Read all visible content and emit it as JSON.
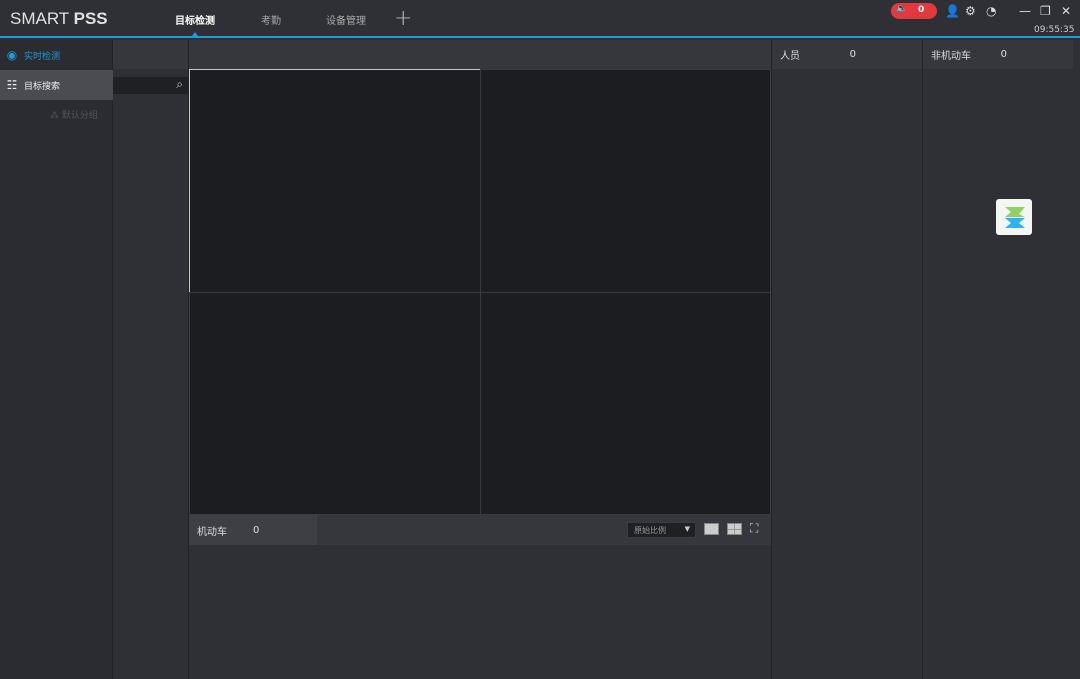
{
  "app": {
    "title_light": "SMART ",
    "title_bold": "PSS",
    "time": "09:55:35",
    "alarm_count": "0"
  },
  "tabs": [
    {
      "label": "目标检测",
      "active": true
    },
    {
      "label": "考勤"
    },
    {
      "label": "设备管理"
    }
  ],
  "add_tab": "+",
  "sidebar": {
    "items": [
      {
        "label": "实时检测",
        "icon": "camera-icon",
        "color": "#1f9ad6"
      },
      {
        "label": "目标搜索",
        "icon": "search-list-icon"
      }
    ]
  },
  "tree": {
    "group": "默认分组"
  },
  "bottom": {
    "motor_label": "机动车",
    "motor_count": "0",
    "ratio": "原始比例"
  },
  "right": {
    "person_label": "人员",
    "person_count": "0",
    "nonmotor_label": "非机动车",
    "nonmotor_count": "0"
  },
  "colors": {
    "accent": "#1f9ad6",
    "alarm": "#e0393e"
  }
}
